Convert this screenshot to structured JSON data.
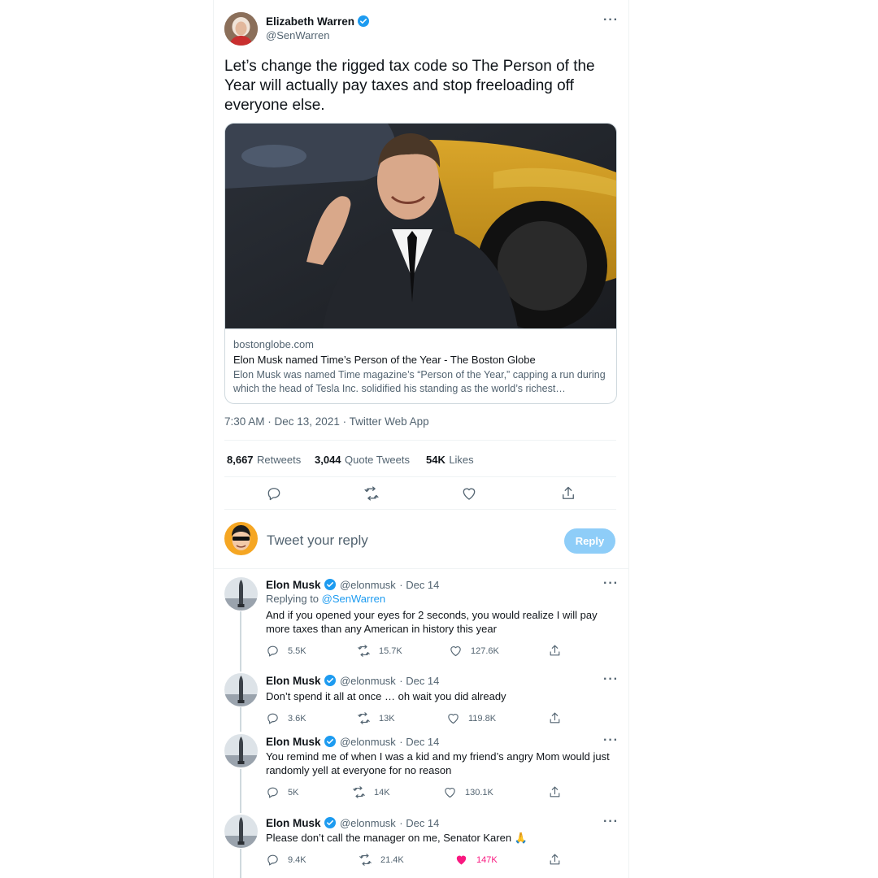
{
  "main_tweet": {
    "author_name": "Elizabeth Warren",
    "author_handle": "@SenWarren",
    "text": "Let’s change the rigged tax code so The Person of the Year will actually pay taxes and stop freeloading off everyone else.",
    "card": {
      "domain": "bostonglobe.com",
      "title": "Elon Musk named Time’s Person of the Year - The Boston Globe",
      "description": "Elon Musk was named Time magazine’s “Person of the Year,” capping a run during which the head of Tesla Inc. solidified his standing as the world’s richest…"
    },
    "timestamp": "7:30 AM · Dec 13, 2021 · Twitter Web App",
    "stats": {
      "retweets_count": "8,667",
      "retweets_label": "Retweets",
      "quotes_count": "3,044",
      "quotes_label": "Quote Tweets",
      "likes_count": "54K",
      "likes_label": "Likes"
    }
  },
  "composer": {
    "placeholder": "Tweet your reply",
    "reply_button": "Reply"
  },
  "replies": [
    {
      "name": "Elon Musk",
      "handle": "@elonmusk",
      "date": "· Dec 14",
      "replying_prefix": "Replying to ",
      "replying_to": "@SenWarren",
      "text": "And if you opened your eyes for 2 seconds, you would realize I will pay more taxes than any American in history this year",
      "replies": "5.5K",
      "retweets": "15.7K",
      "likes": "127.6K",
      "liked": false
    },
    {
      "name": "Elon Musk",
      "handle": "@elonmusk",
      "date": "· Dec 14",
      "text": "Don’t spend it all at once … oh wait you did already",
      "replies": "3.6K",
      "retweets": "13K",
      "likes": "119.8K",
      "liked": false
    },
    {
      "name": "Elon Musk",
      "handle": "@elonmusk",
      "date": "· Dec 14",
      "text": "You remind me of when I was a kid and my friend’s angry Mom would just randomly yell at everyone for no reason",
      "replies": "5K",
      "retweets": "14K",
      "likes": "130.1K",
      "liked": false
    },
    {
      "name": "Elon Musk",
      "handle": "@elonmusk",
      "date": "· Dec 14",
      "text": "Please don’t call the manager on me, Senator Karen 🙏",
      "replies": "9.4K",
      "retweets": "21.4K",
      "likes": "147K",
      "liked": true
    }
  ],
  "colors": {
    "accent": "#1d9bf0",
    "like": "#f91880",
    "muted": "#536471"
  },
  "icons": [
    "verified-badge-icon",
    "more-icon",
    "reply-icon",
    "retweet-icon",
    "like-icon",
    "share-icon"
  ]
}
